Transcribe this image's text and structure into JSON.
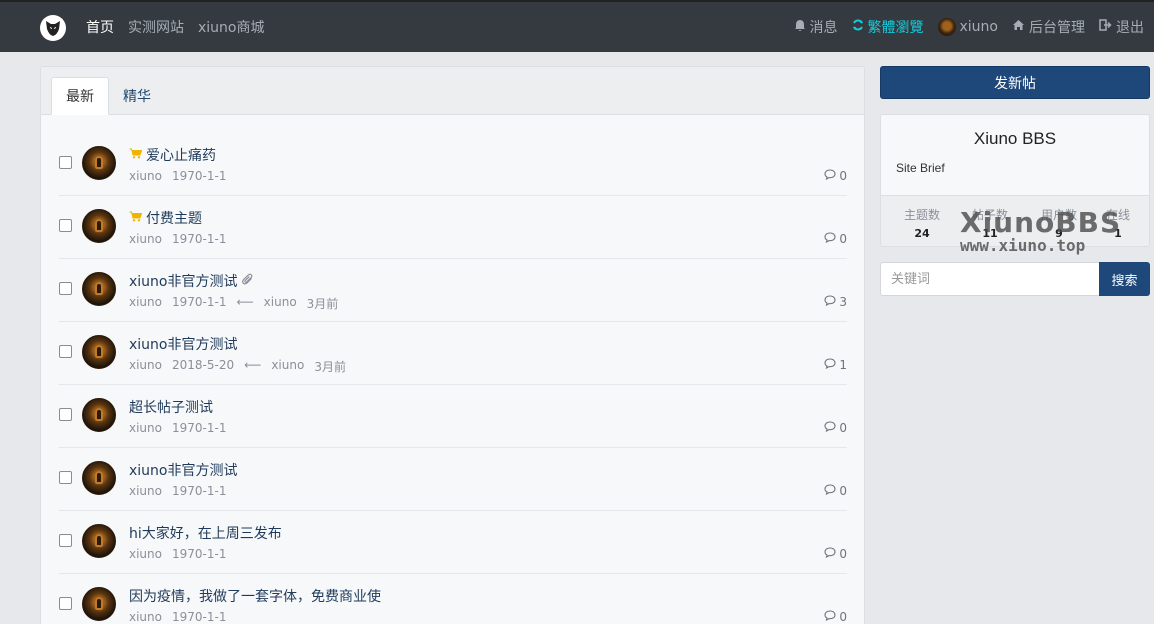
{
  "nav": {
    "left": [
      {
        "label": "首页",
        "active": true
      },
      {
        "label": "实测网站",
        "active": false
      },
      {
        "label": "xiuno商城",
        "active": false
      }
    ],
    "right": {
      "messages": "消息",
      "traditional": "繁體瀏覽",
      "user": "xiuno",
      "admin": "后台管理",
      "logout": "退出"
    }
  },
  "tabs": [
    "最新",
    "精华"
  ],
  "threads": [
    {
      "title": "爱心止痛药",
      "icon": "cart-icon",
      "user": "xiuno",
      "date": "1970-1-1",
      "last_user": "",
      "last_time": "",
      "replies": "0"
    },
    {
      "title": "付费主题",
      "icon": "cart-icon",
      "user": "xiuno",
      "date": "1970-1-1",
      "last_user": "",
      "last_time": "",
      "replies": "0"
    },
    {
      "title": "xiuno非官方测试",
      "icon": "paperclip-icon",
      "user": "xiuno",
      "date": "1970-1-1",
      "last_user": "xiuno",
      "last_time": "3月前",
      "replies": "3"
    },
    {
      "title": "xiuno非官方测试",
      "icon": "",
      "user": "xiuno",
      "date": "2018-5-20",
      "last_user": "xiuno",
      "last_time": "3月前",
      "replies": "1"
    },
    {
      "title": "超长帖子测试",
      "icon": "",
      "user": "xiuno",
      "date": "1970-1-1",
      "last_user": "",
      "last_time": "",
      "replies": "0"
    },
    {
      "title": "xiuno非官方测试",
      "icon": "",
      "user": "xiuno",
      "date": "1970-1-1",
      "last_user": "",
      "last_time": "",
      "replies": "0"
    },
    {
      "title": "hi大家好，在上周三发布",
      "icon": "",
      "user": "xiuno",
      "date": "1970-1-1",
      "last_user": "",
      "last_time": "",
      "replies": "0"
    },
    {
      "title": "因为疫情，我做了一套字体，免费商业使",
      "icon": "",
      "user": "xiuno",
      "date": "1970-1-1",
      "last_user": "",
      "last_time": "",
      "replies": "0"
    }
  ],
  "sidebar": {
    "new_post": "发新帖",
    "site_name": "Xiuno BBS",
    "site_brief": "Site Brief",
    "stats": [
      {
        "label": "主题数",
        "value": "24"
      },
      {
        "label": "帖子数",
        "value": "11"
      },
      {
        "label": "用户数",
        "value": "9"
      },
      {
        "label": "在线",
        "value": "1"
      }
    ],
    "search_placeholder": "关键词",
    "search_button": "搜索"
  },
  "watermark": {
    "line1": "XiunoBBS",
    "line2": "www.xiuno.top"
  },
  "colors": {
    "navbar": "#343a40",
    "primary": "#1e477a",
    "cyan": "#17c9d9",
    "cart": "#f0b400"
  }
}
